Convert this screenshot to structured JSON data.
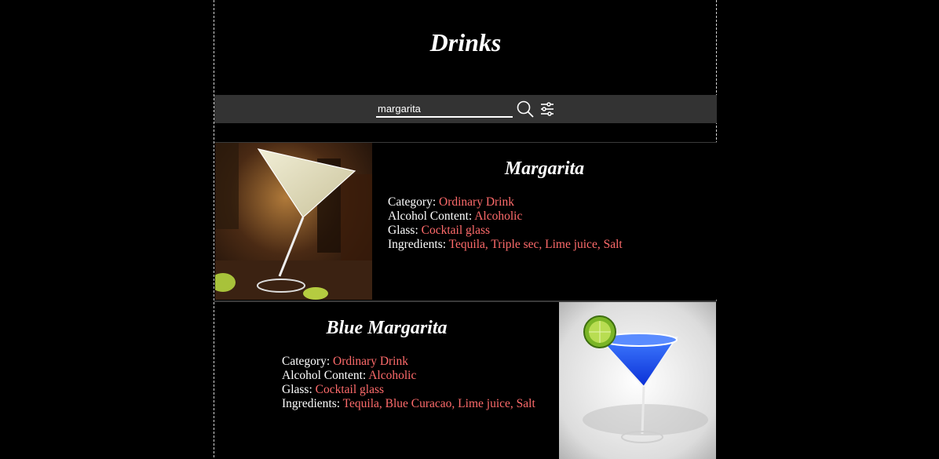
{
  "header": {
    "title": "Drinks"
  },
  "search": {
    "value": "margarita"
  },
  "drinks": [
    {
      "name": "Margarita",
      "category_label": "Category: ",
      "category": "Ordinary Drink",
      "alcohol_label": "Alcohol Content: ",
      "alcohol": "Alcoholic",
      "glass_label": "Glass: ",
      "glass": "Cocktail glass",
      "ingredients_label": "Ingredients: ",
      "ingredients": "Tequila, Triple sec, Lime juice, Salt"
    },
    {
      "name": "Blue Margarita",
      "category_label": "Category: ",
      "category": "Ordinary Drink",
      "alcohol_label": "Alcohol Content: ",
      "alcohol": "Alcoholic",
      "glass_label": "Glass: ",
      "glass": "Cocktail glass",
      "ingredients_label": "Ingredients: ",
      "ingredients": "Tequila, Blue Curacao, Lime juice, Salt"
    }
  ],
  "colors": {
    "background": "#000000",
    "bar": "#333333",
    "link": "#ff6b6b",
    "text": "#ffffff"
  },
  "icons": {
    "search": "search-icon",
    "filter": "sliders-icon"
  }
}
